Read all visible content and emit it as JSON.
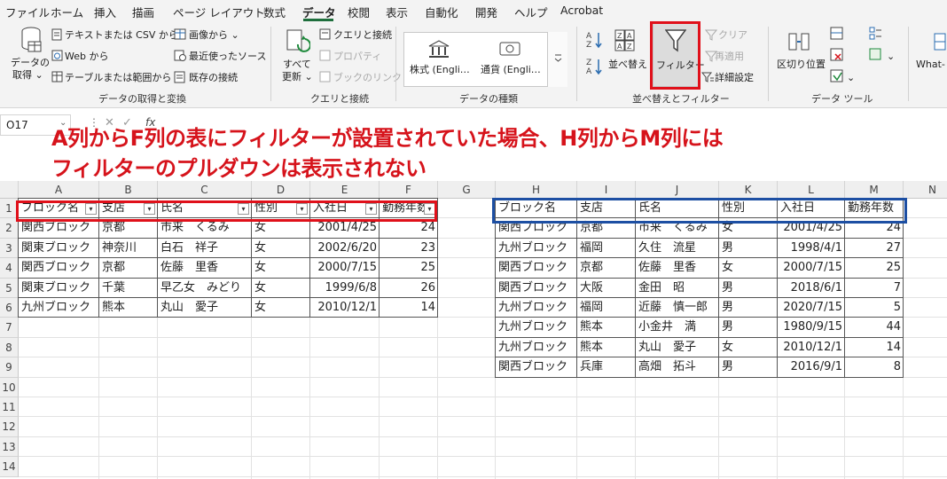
{
  "menubar": {
    "items": [
      "ファイル",
      "ホーム",
      "挿入",
      "描画",
      "ページ レイアウト",
      "数式",
      "データ",
      "校閲",
      "表示",
      "自動化",
      "開発",
      "ヘルプ",
      "Acrobat"
    ],
    "active": "データ"
  },
  "ribbon": {
    "get_data": {
      "label": "データの取得と変換",
      "get_data_btn_line1": "データの",
      "get_data_btn_line2": "取得 ⌄",
      "from_text_csv": "テキストまたは CSV から",
      "from_web": "Web から",
      "from_table": "テーブルまたは範囲から",
      "from_picture": "画像から ⌄",
      "recent_sources": "最近使ったソース",
      "existing_connections": "既存の接続"
    },
    "queries": {
      "label": "クエリと接続",
      "refresh_all_line1": "すべて",
      "refresh_all_line2": "更新 ⌄",
      "queries_connections": "クエリと接続",
      "properties": "プロパティ",
      "edit_links": "ブックのリンク"
    },
    "data_types": {
      "label": "データの種類",
      "stocks": "株式 (Engli…",
      "currencies": "通貨 (Engli…"
    },
    "sort_filter": {
      "label": "並べ替えとフィルター",
      "sort": "並べ替え",
      "filter": "フィルター",
      "clear": "クリア",
      "reapply": "再適用",
      "advanced": "詳細設定"
    },
    "data_tools": {
      "label": "データ ツール",
      "text_to_columns": "区切り位置"
    },
    "whatif": "What-"
  },
  "formula_bar": {
    "name_box": "O17",
    "fx": "fx"
  },
  "annotation": {
    "line1": "A列からF列の表にフィルターが設置されていた場合、H列からM列には",
    "line2": "フィルターのプルダウンは表示されない"
  },
  "columns": [
    "A",
    "B",
    "C",
    "D",
    "E",
    "F",
    "G",
    "H",
    "I",
    "J",
    "K",
    "L",
    "M",
    "N"
  ],
  "rows": [
    "1",
    "2",
    "3",
    "4",
    "5",
    "6",
    "7",
    "8",
    "9",
    "10",
    "11",
    "12",
    "13",
    "14"
  ],
  "left_table": {
    "headers": [
      "ブロック名",
      "支店",
      "氏名",
      "性別",
      "入社日",
      "勤務年数"
    ],
    "rows": [
      [
        "関西ブロック",
        "京都",
        "市来　くるみ",
        "女",
        "2001/4/25",
        "24"
      ],
      [
        "関東ブロック",
        "神奈川",
        "白石　祥子",
        "女",
        "2002/6/20",
        "23"
      ],
      [
        "関西ブロック",
        "京都",
        "佐藤　里香",
        "女",
        "2000/7/15",
        "25"
      ],
      [
        "関東ブロック",
        "千葉",
        "早乙女　みどり",
        "女",
        "1999/6/8",
        "26"
      ],
      [
        "九州ブロック",
        "熊本",
        "丸山　愛子",
        "女",
        "2010/12/1",
        "14"
      ]
    ]
  },
  "right_table": {
    "headers": [
      "ブロック名",
      "支店",
      "氏名",
      "性別",
      "入社日",
      "勤務年数"
    ],
    "rows": [
      [
        "関西ブロック",
        "京都",
        "市来　くるみ",
        "女",
        "2001/4/25",
        "24"
      ],
      [
        "九州ブロック",
        "福岡",
        "久住　流星",
        "男",
        "1998/4/1",
        "27"
      ],
      [
        "関西ブロック",
        "京都",
        "佐藤　里香",
        "女",
        "2000/7/15",
        "25"
      ],
      [
        "関西ブロック",
        "大阪",
        "金田　昭",
        "男",
        "2018/6/1",
        "7"
      ],
      [
        "九州ブロック",
        "福岡",
        "近藤　慎一郎",
        "男",
        "2020/7/15",
        "5"
      ],
      [
        "九州ブロック",
        "熊本",
        "小金井　満",
        "男",
        "1980/9/15",
        "44"
      ],
      [
        "九州ブロック",
        "熊本",
        "丸山　愛子",
        "女",
        "2010/12/1",
        "14"
      ],
      [
        "関西ブロック",
        "兵庫",
        "高畑　拓斗",
        "男",
        "2016/9/1",
        "8"
      ]
    ]
  },
  "colors": {
    "accent_green": "#1e6e3c",
    "annotation_red": "#d6131b",
    "highlight_red": "#e0101a",
    "highlight_blue": "#1d4fa3"
  }
}
